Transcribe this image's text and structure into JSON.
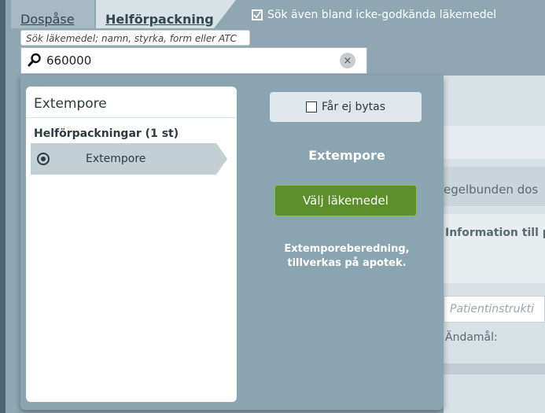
{
  "tabs": [
    {
      "label": "Dospåse"
    },
    {
      "label": "Helförpackning"
    }
  ],
  "search_also_label": "Sök även bland icke-godkända läkemedel",
  "search": {
    "tooltip": "Sök läkemedel; namn, styrka, form eller ATC",
    "value": "660000",
    "clear_icon": "×"
  },
  "background_form": {
    "section1": "egelbunden dos",
    "section2": "Information till p",
    "patient_placeholder": "Patientinstrukti",
    "purpose_label": "Ändamål:"
  },
  "results": {
    "title": "Extempore",
    "group_label": "Helförpackningar (1 st)",
    "items": [
      {
        "label": "Extempore",
        "selected": true
      }
    ]
  },
  "detail": {
    "no_substitute_label": "Får ej bytas",
    "name": "Extempore",
    "select_button": "Välj läkemedel",
    "description_line1": "Extemporeberedning,",
    "description_line2": "tillverkas på apotek."
  },
  "colors": {
    "accent_green": "#5a8f2a",
    "panel_blue": "#8aa4b1"
  }
}
